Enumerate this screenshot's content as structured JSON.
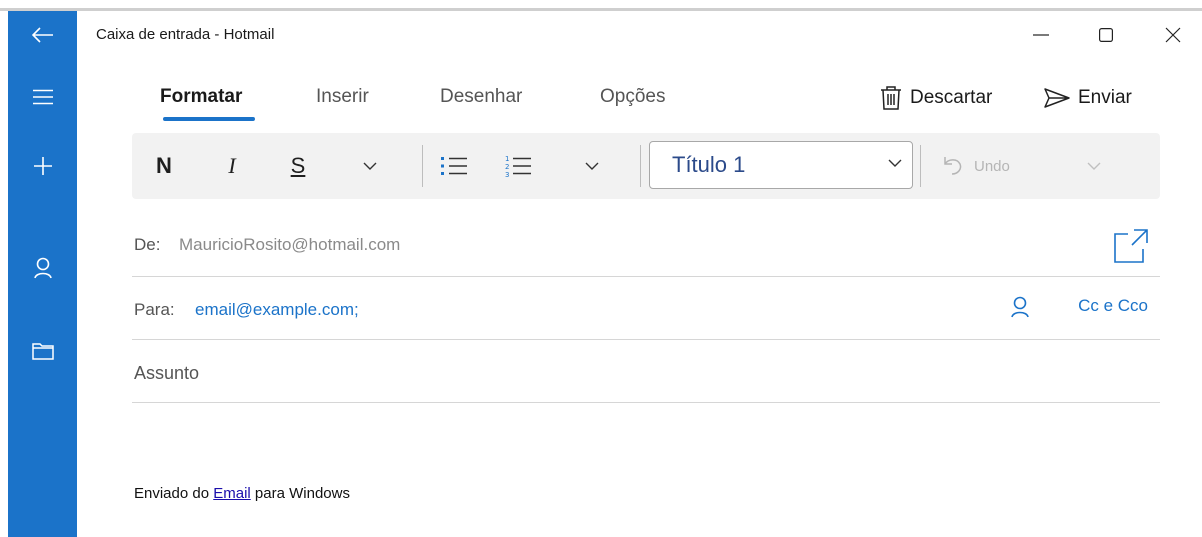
{
  "window": {
    "title": "Caixa de entrada - Hotmail"
  },
  "rail": {
    "items": [
      "back-arrow-icon",
      "hamburger-menu-icon",
      "new-mail-plus-icon",
      "person-icon",
      "folder-icon"
    ]
  },
  "tabs": [
    {
      "label": "Formatar",
      "active": true
    },
    {
      "label": "Inserir",
      "active": false
    },
    {
      "label": "Desenhar",
      "active": false
    },
    {
      "label": "Opções",
      "active": false
    }
  ],
  "actions": {
    "discard_label": "Descartar",
    "send_label": "Enviar"
  },
  "toolbar": {
    "bold_label": "N",
    "italic_label": "I",
    "underline_label": "S",
    "style_value": "Título 1",
    "undo_label": "Undo"
  },
  "fields": {
    "from_label": "De:",
    "from_value": "MauricioRosito@hotmail.com",
    "to_label": "Para:",
    "to_value": "email@example.com;",
    "ccbcc_label": "Cc e Cco",
    "subject_placeholder": "Assunto"
  },
  "body": {
    "signature_prefix": "Enviado do ",
    "signature_link": "Email",
    "signature_suffix": " para Windows"
  },
  "colors": {
    "accent": "#1b73c9",
    "toolbar_bg": "#f2f2f2"
  }
}
